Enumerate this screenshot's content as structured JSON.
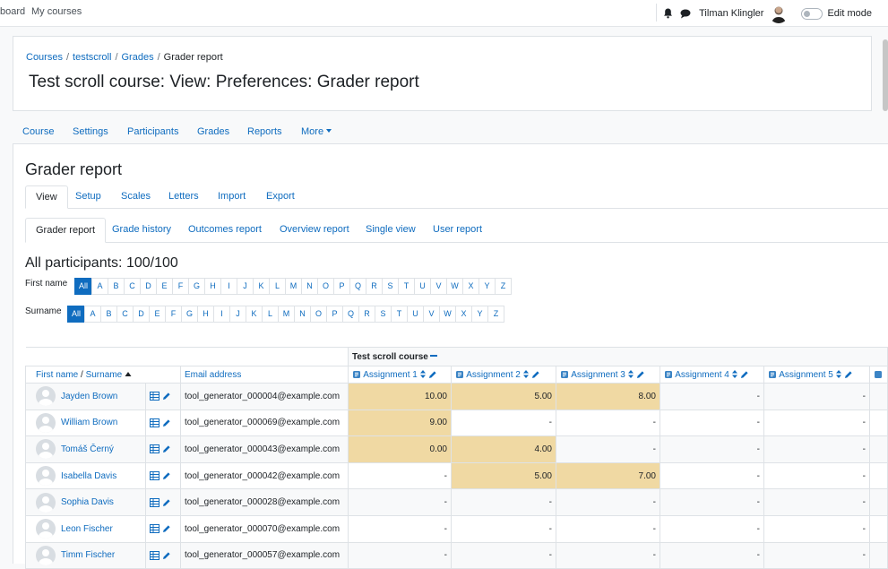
{
  "navbar": {
    "links": [
      "board",
      "My courses"
    ],
    "user_name": "Tilman Klingler",
    "edit_mode_label": "Edit mode"
  },
  "breadcrumb": [
    "Courses",
    "testscroll",
    "Grades",
    "Grader report"
  ],
  "page_title": "Test scroll course: View: Preferences: Grader report",
  "secondary_nav": [
    "Course",
    "Settings",
    "Participants",
    "Grades",
    "Reports",
    "More"
  ],
  "main": {
    "heading": "Grader report",
    "tabs": [
      "View",
      "Setup",
      "Scales",
      "Letters",
      "Import",
      "Export"
    ],
    "subtabs": [
      "Grader report",
      "Grade history",
      "Outcomes report",
      "Overview report",
      "Single view",
      "User report"
    ],
    "participants_title": "All participants: 100/100",
    "first_name_label": "First name",
    "surname_label": "Surname",
    "letters": [
      "All",
      "A",
      "B",
      "C",
      "D",
      "E",
      "F",
      "G",
      "H",
      "I",
      "J",
      "K",
      "L",
      "M",
      "N",
      "O",
      "P",
      "Q",
      "R",
      "S",
      "T",
      "U",
      "V",
      "W",
      "X",
      "Y",
      "Z"
    ]
  },
  "grid": {
    "category": "Test scroll course",
    "col_first_name": "First name",
    "col_slash": " / ",
    "col_surname": "Surname",
    "col_email": "Email address",
    "assignments": [
      "Assignment 1",
      "Assignment 2",
      "Assignment 3",
      "Assignment 4",
      "Assignment 5"
    ],
    "rows": [
      {
        "name": "Jayden Brown",
        "email": "tool_generator_000004@example.com",
        "grades": [
          "10.00",
          "5.00",
          "8.00",
          "-",
          "-"
        ],
        "hl": [
          true,
          true,
          true,
          false,
          false
        ]
      },
      {
        "name": "William Brown",
        "email": "tool_generator_000069@example.com",
        "grades": [
          "9.00",
          "-",
          "-",
          "-",
          "-"
        ],
        "hl": [
          true,
          false,
          false,
          false,
          false
        ]
      },
      {
        "name": "Tomáš Černý",
        "email": "tool_generator_000043@example.com",
        "grades": [
          "0.00",
          "4.00",
          "-",
          "-",
          "-"
        ],
        "hl": [
          true,
          true,
          false,
          false,
          false
        ]
      },
      {
        "name": "Isabella Davis",
        "email": "tool_generator_000042@example.com",
        "grades": [
          "-",
          "5.00",
          "7.00",
          "-",
          "-"
        ],
        "hl": [
          false,
          true,
          true,
          false,
          false
        ]
      },
      {
        "name": "Sophia Davis",
        "email": "tool_generator_000028@example.com",
        "grades": [
          "-",
          "-",
          "-",
          "-",
          "-"
        ],
        "hl": [
          false,
          false,
          false,
          false,
          false
        ]
      },
      {
        "name": "Leon Fischer",
        "email": "tool_generator_000070@example.com",
        "grades": [
          "-",
          "-",
          "-",
          "-",
          "-"
        ],
        "hl": [
          false,
          false,
          false,
          false,
          false
        ]
      },
      {
        "name": "Timm Fischer",
        "email": "tool_generator_000057@example.com",
        "grades": [
          "-",
          "-",
          "-",
          "-",
          "-"
        ],
        "hl": [
          false,
          false,
          false,
          false,
          false
        ]
      }
    ]
  },
  "colors": {
    "link": "#0f6cbf",
    "highlight": "#f0d9a3"
  }
}
